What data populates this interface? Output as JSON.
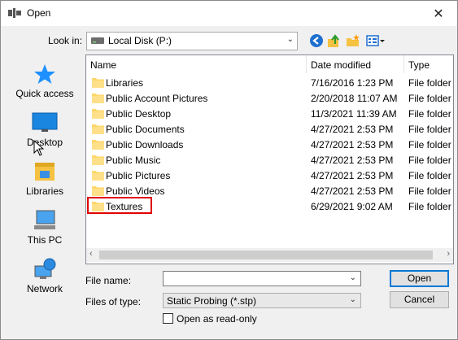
{
  "window": {
    "title": "Open",
    "close_glyph": "✕"
  },
  "toolbar": {
    "look_in_label": "Look in:",
    "look_in_value": "Local Disk (P:)",
    "icons": [
      "back-icon",
      "up-folder-icon",
      "new-folder-icon",
      "view-menu-icon"
    ]
  },
  "places": [
    {
      "label": "Quick access",
      "icon": "star-icon"
    },
    {
      "label": "Desktop",
      "icon": "desktop-icon"
    },
    {
      "label": "Libraries",
      "icon": "libraries-icon"
    },
    {
      "label": "This PC",
      "icon": "computer-icon"
    },
    {
      "label": "Network",
      "icon": "network-icon"
    }
  ],
  "columns": {
    "name": "Name",
    "date": "Date modified",
    "type": "Type"
  },
  "rows": [
    {
      "name": "Libraries",
      "date": "7/16/2016 1:23 PM",
      "type": "File folder"
    },
    {
      "name": "Public Account Pictures",
      "date": "2/20/2018 11:07 AM",
      "type": "File folder"
    },
    {
      "name": "Public Desktop",
      "date": "11/3/2021 11:39 AM",
      "type": "File folder"
    },
    {
      "name": "Public Documents",
      "date": "4/27/2021 2:53 PM",
      "type": "File folder"
    },
    {
      "name": "Public Downloads",
      "date": "4/27/2021 2:53 PM",
      "type": "File folder"
    },
    {
      "name": "Public Music",
      "date": "4/27/2021 2:53 PM",
      "type": "File folder"
    },
    {
      "name": "Public Pictures",
      "date": "4/27/2021 2:53 PM",
      "type": "File folder"
    },
    {
      "name": "Public Videos",
      "date": "4/27/2021 2:53 PM",
      "type": "File folder"
    },
    {
      "name": "Textures",
      "date": "6/29/2021 9:02 AM",
      "type": "File folder"
    }
  ],
  "form": {
    "file_name_label": "File name:",
    "file_name_value": "",
    "files_of_type_label": "Files of type:",
    "files_of_type_value": "Static Probing (*.stp)",
    "read_only_label": "Open as read-only"
  },
  "buttons": {
    "open": "Open",
    "cancel": "Cancel"
  },
  "colors": {
    "folder": "#ffd769",
    "highlight_border": "#e00000",
    "accent": "#0078d7"
  }
}
